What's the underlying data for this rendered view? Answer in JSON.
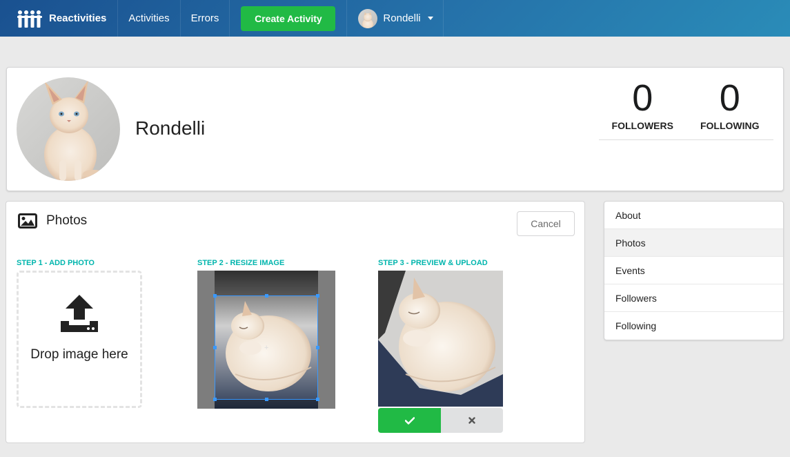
{
  "navbar": {
    "brand": "Reactivities",
    "links": [
      "Activities",
      "Errors"
    ],
    "create_label": "Create Activity",
    "username": "Rondelli",
    "brand_icon": "people-logo-icon",
    "caret_icon": "caret-down-icon"
  },
  "profile": {
    "name": "Rondelli",
    "followers_count": "0",
    "followers_label": "FOLLOWERS",
    "following_count": "0",
    "following_label": "FOLLOWING"
  },
  "photos": {
    "title": "Photos",
    "title_icon": "image-icon",
    "cancel_label": "Cancel",
    "step1": "STEP 1 - ADD PHOTO",
    "step2": "STEP 2 - RESIZE IMAGE",
    "step3": "STEP 3 - PREVIEW & UPLOAD",
    "dropzone_text": "Drop image here",
    "dropzone_icon": "upload-icon",
    "confirm_icon": "check-icon",
    "reject_icon": "close-icon"
  },
  "side_menu": {
    "items": [
      "About",
      "Photos",
      "Events",
      "Followers",
      "Following"
    ],
    "active": "Photos"
  },
  "colors": {
    "accent_green": "#21ba45",
    "teal": "#00b5ad",
    "nav_start": "#1a5190",
    "nav_end": "#2a8cb8"
  }
}
